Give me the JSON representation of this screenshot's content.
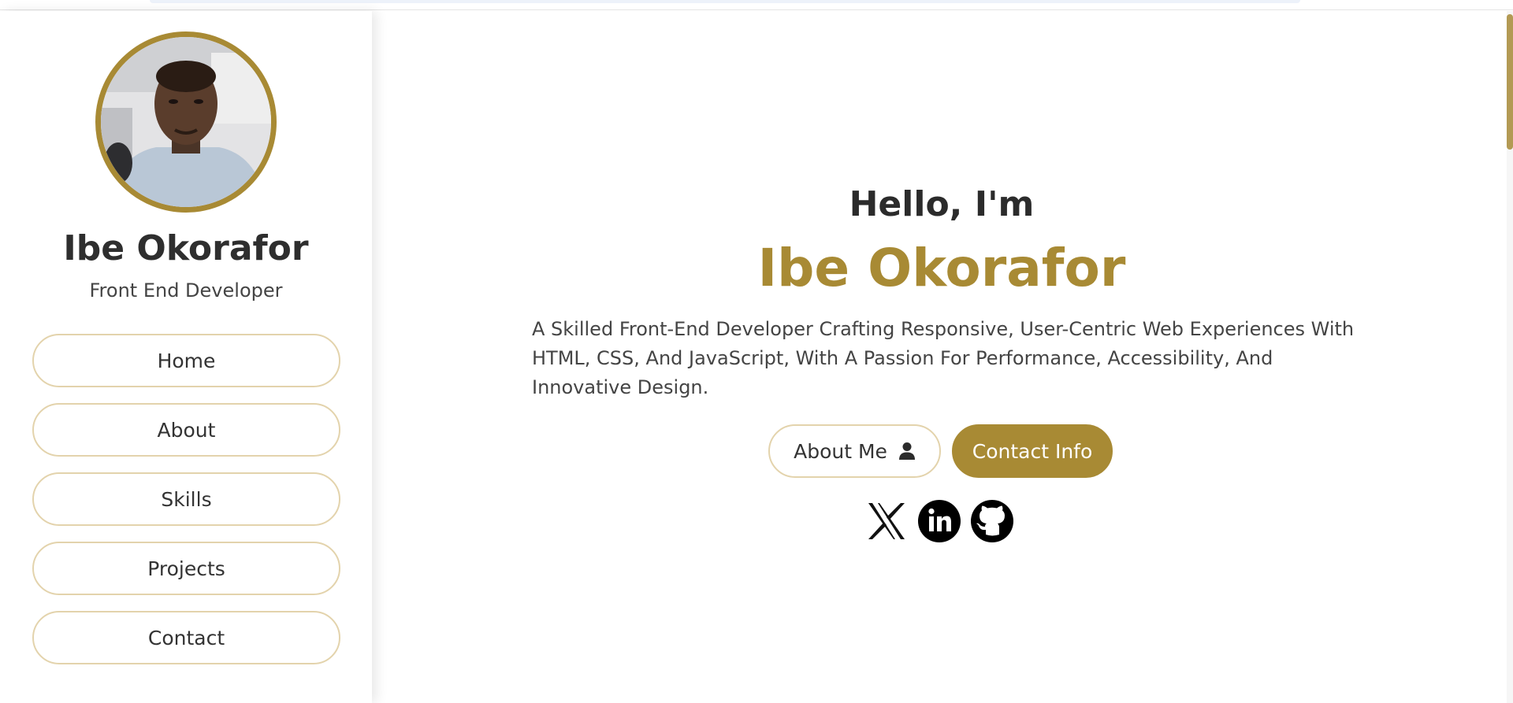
{
  "profile": {
    "name": "Ibe Okorafor",
    "role": "Front End Developer"
  },
  "nav": {
    "items": [
      {
        "label": "Home"
      },
      {
        "label": "About"
      },
      {
        "label": "Skills"
      },
      {
        "label": "Projects"
      },
      {
        "label": "Contact"
      }
    ]
  },
  "hero": {
    "greeting": "Hello, I'm",
    "name": "Ibe Okorafor",
    "description": "A Skilled Front-End Developer Crafting Responsive, User-Centric Web Experiences With HTML, CSS, And JavaScript, With A Passion For Performance, Accessibility, And Innovative Design.",
    "about_button": "About Me",
    "contact_button": "Contact Info"
  },
  "icons": {
    "about_button_icon": "user-icon",
    "social": [
      "x-twitter-icon",
      "linkedin-icon",
      "github-icon"
    ]
  },
  "colors": {
    "accent": "#a88a34",
    "outline": "#e3d3ac",
    "text": "#333333"
  }
}
